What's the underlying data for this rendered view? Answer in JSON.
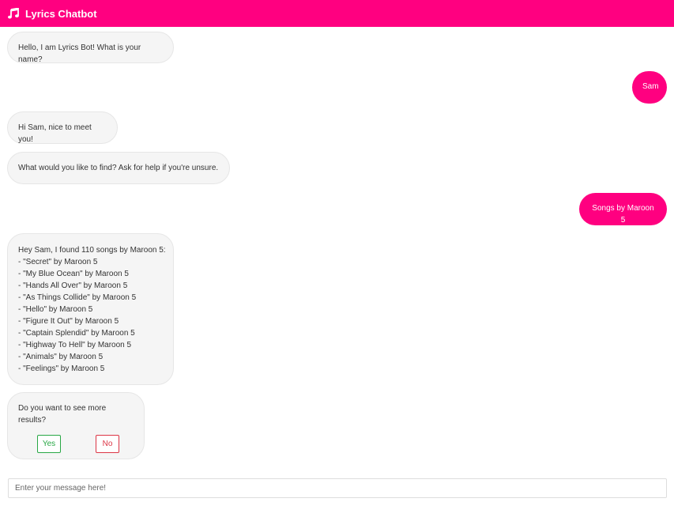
{
  "header": {
    "title": "Lyrics Chatbot",
    "icon": "music-note-icon",
    "color": "#ff0080"
  },
  "messages": {
    "m1": "Hello, I am Lyrics Bot! What is your name?",
    "m2": "Sam",
    "m3": "Hi Sam, nice to meet you!",
    "m4": "What would you like to find? Ask for help if you're unsure.",
    "m5": "Songs by Maroon 5",
    "m6": {
      "intro": "Hey Sam, I found 110 songs by Maroon 5:",
      "songs": [
        "- \"Secret\" by Maroon 5",
        "- \"My Blue Ocean\" by Maroon 5",
        "- \"Hands All Over\" by Maroon 5",
        "- \"As Things Collide\" by Maroon 5",
        "- \"Hello\" by Maroon 5",
        "- \"Figure It Out\" by Maroon 5",
        "- \"Captain Splendid\" by Maroon 5",
        "- \"Highway To Hell\" by Maroon 5",
        "- \"Animals\" by Maroon 5",
        "- \"Feelings\" by Maroon 5"
      ]
    },
    "m7": {
      "question": "Do you want to see more results?",
      "yes_label": "Yes",
      "no_label": "No"
    }
  },
  "input": {
    "placeholder": "Enter your message here!",
    "value": ""
  }
}
